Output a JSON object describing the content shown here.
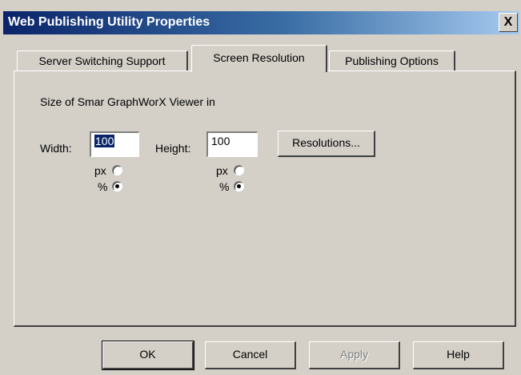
{
  "window": {
    "title": "Web Publishing Utility Properties",
    "close_glyph": "X"
  },
  "tabs": [
    {
      "label": "Server Switching Support",
      "active": false
    },
    {
      "label": "Screen Resolution",
      "active": true
    },
    {
      "label": "Publishing Options",
      "active": false
    }
  ],
  "panel": {
    "heading": "Size of Smar GraphWorX Viewer in",
    "width_label": "Width:",
    "width_value": "100",
    "height_label": "Height:",
    "height_value": "100",
    "resolutions_button": "Resolutions...",
    "width_units": [
      {
        "label": "px",
        "selected": false
      },
      {
        "label": "%",
        "selected": true
      }
    ],
    "height_units": [
      {
        "label": "px",
        "selected": false
      },
      {
        "label": "%",
        "selected": true
      }
    ]
  },
  "buttons": {
    "ok": "OK",
    "cancel": "Cancel",
    "apply": "Apply",
    "help": "Help"
  }
}
